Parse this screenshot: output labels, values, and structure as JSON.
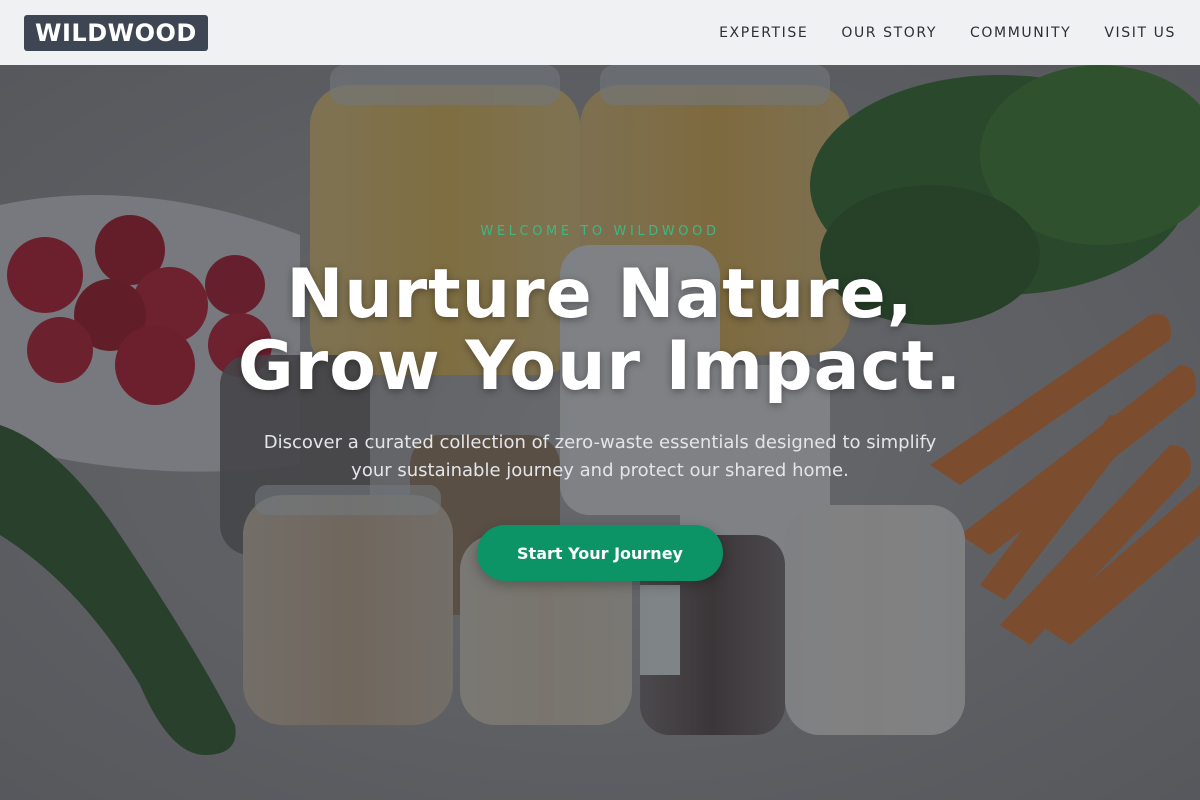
{
  "brand": {
    "logo_text": "WILDWOOD"
  },
  "nav": {
    "items": [
      {
        "label": "EXPERTISE"
      },
      {
        "label": "OUR STORY"
      },
      {
        "label": "COMMUNITY"
      },
      {
        "label": "VISIT US"
      }
    ]
  },
  "hero": {
    "eyebrow": "WELCOME TO WILDWOOD",
    "headline_line1": "Nurture Nature,",
    "headline_line2": "Grow Your Impact.",
    "subtext": "Discover a curated collection of zero-waste essentials designed to simplify your sustainable journey and protect our shared home.",
    "cta_label": "Start Your Journey",
    "image_subject": "zero-waste pantry jars with produce"
  },
  "colors": {
    "accent": "#0d9466",
    "eyebrow": "#3fb784",
    "logo_bg": "#3f4653",
    "header_bg": "#f0f1f2"
  }
}
